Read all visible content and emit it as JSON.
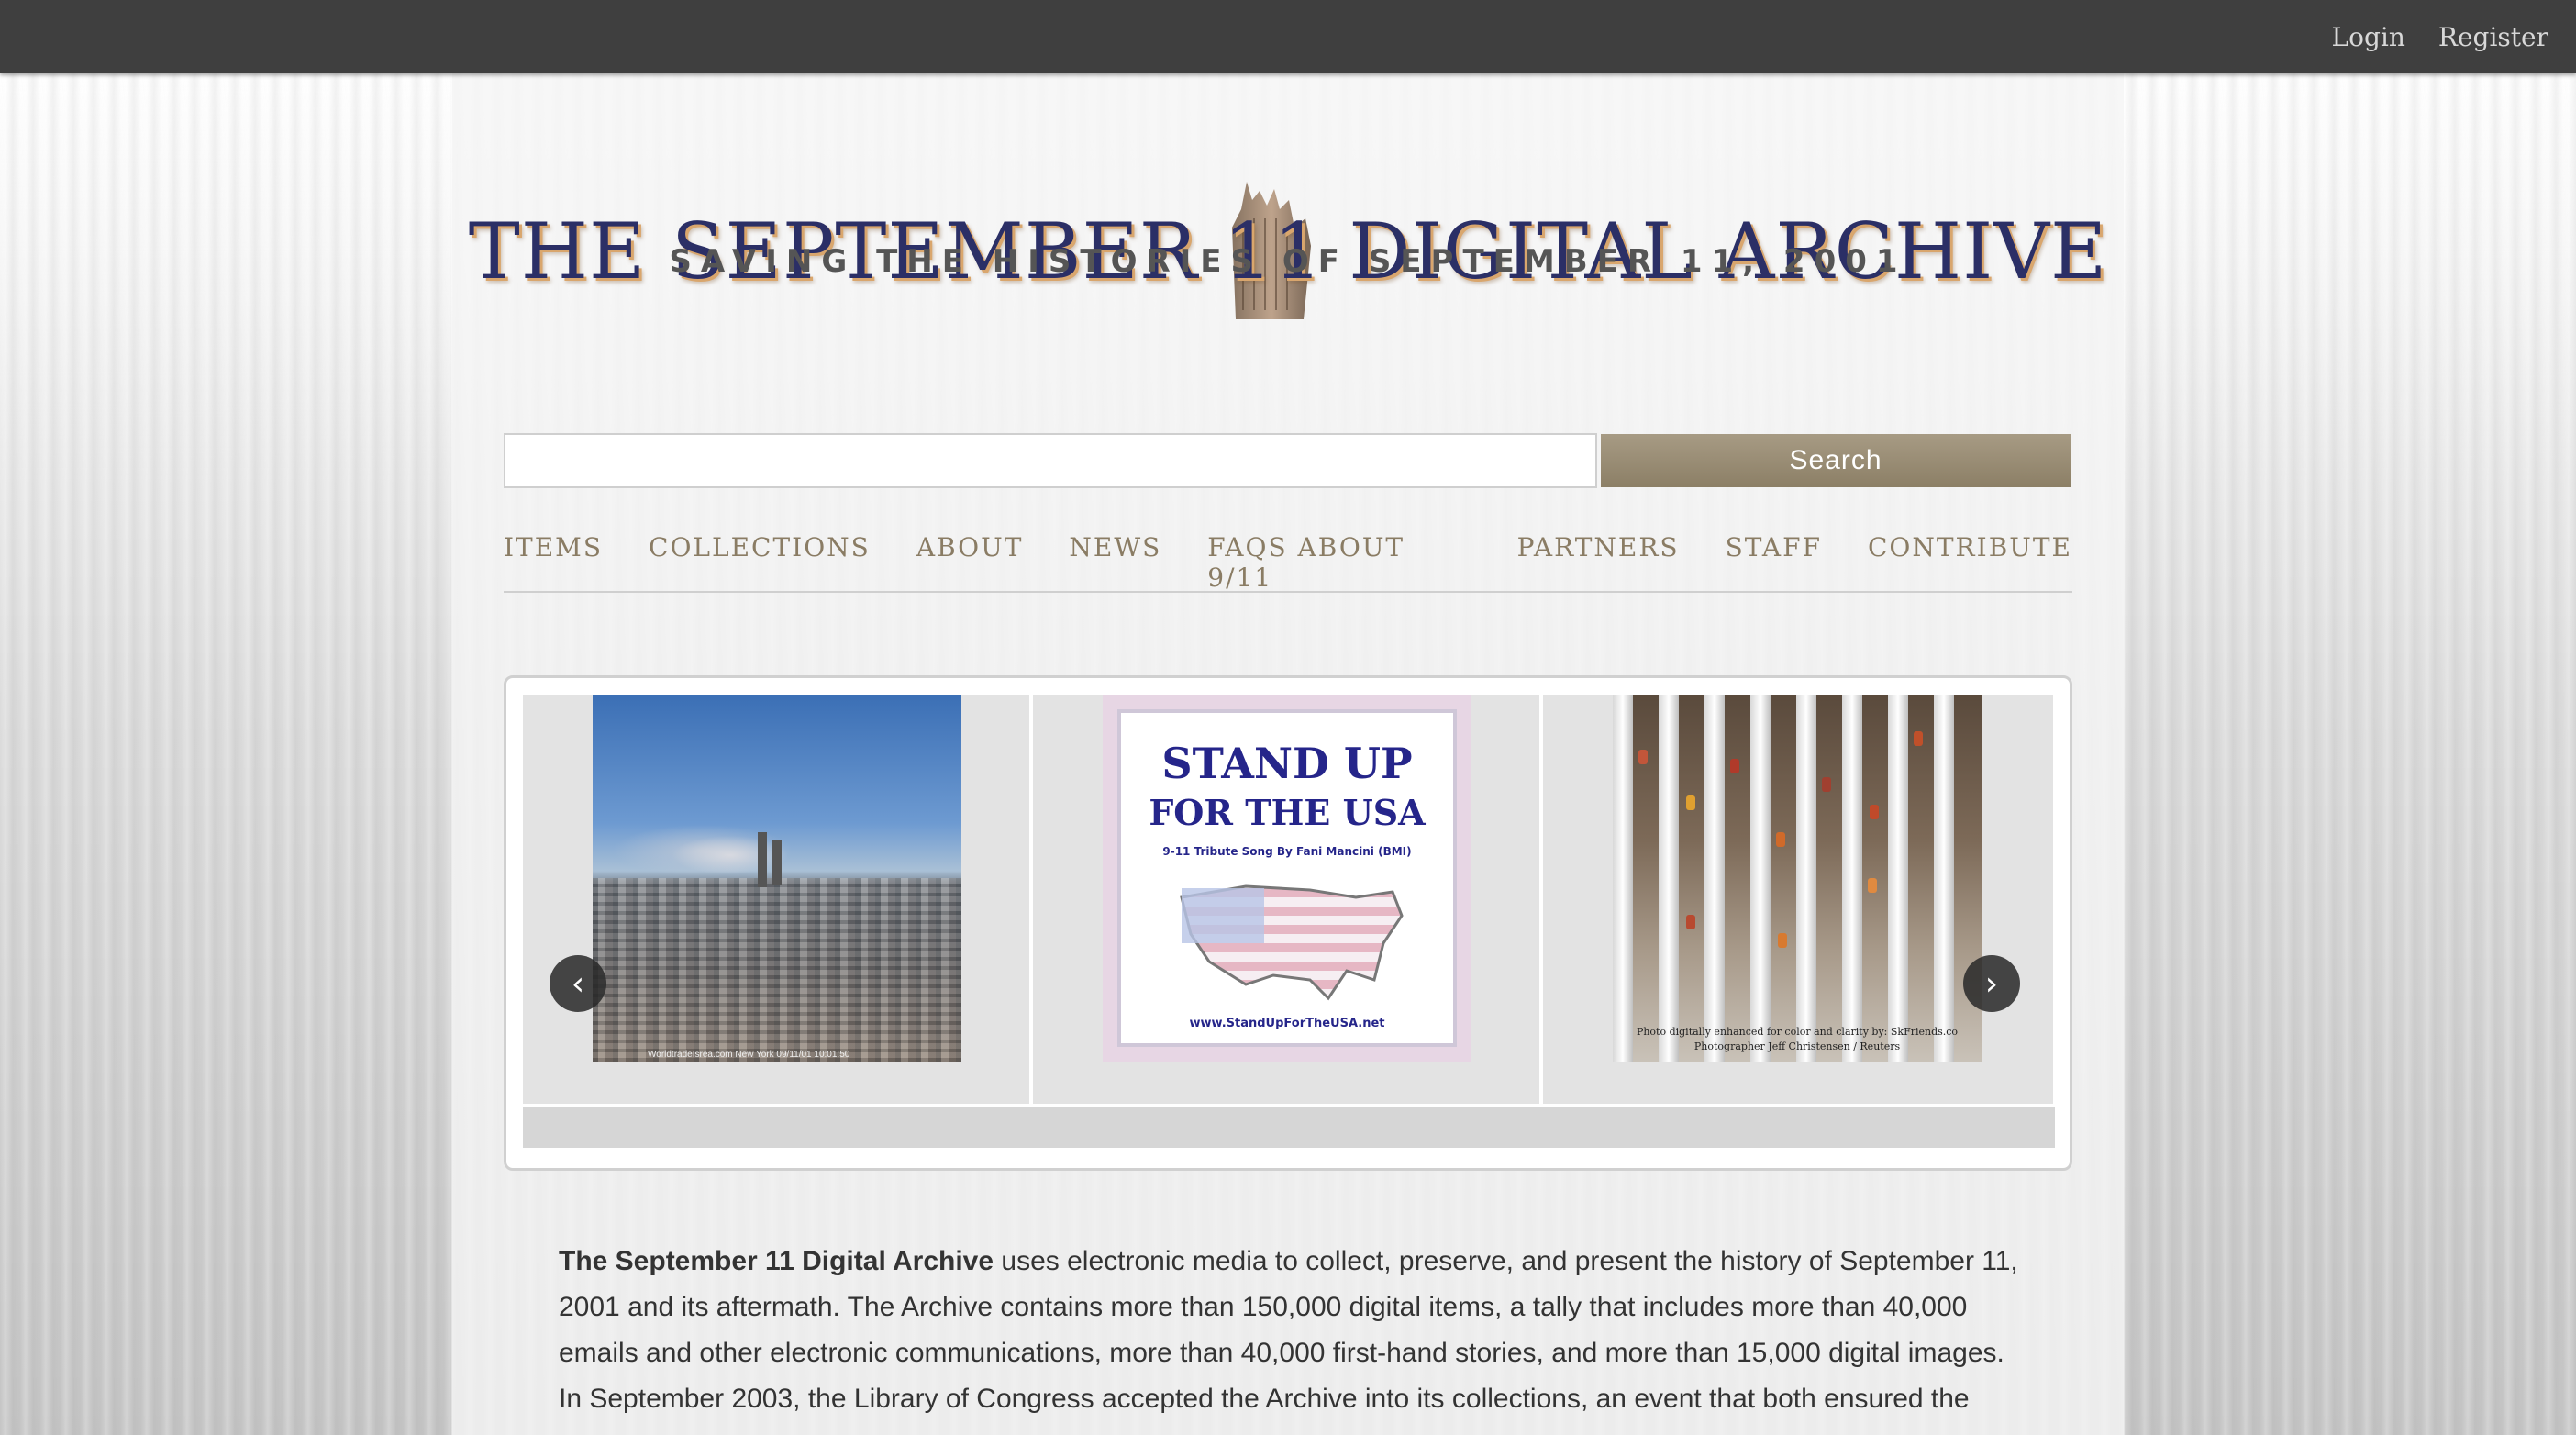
{
  "topbar": {
    "login": "Login",
    "register": "Register"
  },
  "header": {
    "title": "THE SEPTEMBER 11 DIGITAL ARCHIVE",
    "subtitle": "SAVING THE HISTORIES OF SEPTEMBER 11, 2001"
  },
  "search": {
    "value": "",
    "placeholder": "",
    "button_label": "Search"
  },
  "nav": {
    "items": [
      "ITEMS",
      "COLLECTIONS",
      "ABOUT",
      "NEWS",
      "FAQS ABOUT 9/11",
      "PARTNERS",
      "STAFF",
      "CONTRIBUTE"
    ]
  },
  "carousel": {
    "prev_label": "‹",
    "next_label": "›",
    "slides": [
      {
        "caption": "WorldtradeIsrea.com New York 09/11/01 10:01:50"
      },
      {
        "title_line1": "STAND UP",
        "title_line2": "FOR THE USA",
        "subtitle": "9-11 Tribute Song By Fani Mancini (BMI)",
        "url": "www.StandUpForTheUSA.net"
      },
      {
        "caption_line1": "Photo digitally enhanced for color and clarity by: SkFriends.co",
        "caption_line2": "Photographer Jeff Christensen / Reuters"
      }
    ]
  },
  "intro": {
    "bold": "The September 11 Digital Archive",
    "text": " uses electronic media to collect, preserve, and present the history of September 11, 2001 and its aftermath. The Archive contains more than 150,000 digital items, a tally that includes more than 40,000 emails and other electronic communications, more than 40,000 first-hand stories, and more than 15,000 digital images. In September 2003, the Library of Congress accepted the Archive into its collections, an event that both ensured the"
  },
  "colors": {
    "topbar": "#3f3f3f",
    "nav_text": "#8a7c64",
    "search_button": "#8c7f66",
    "logo_blue": "#2b2f66",
    "logo_shadow": "#d9a66d"
  }
}
